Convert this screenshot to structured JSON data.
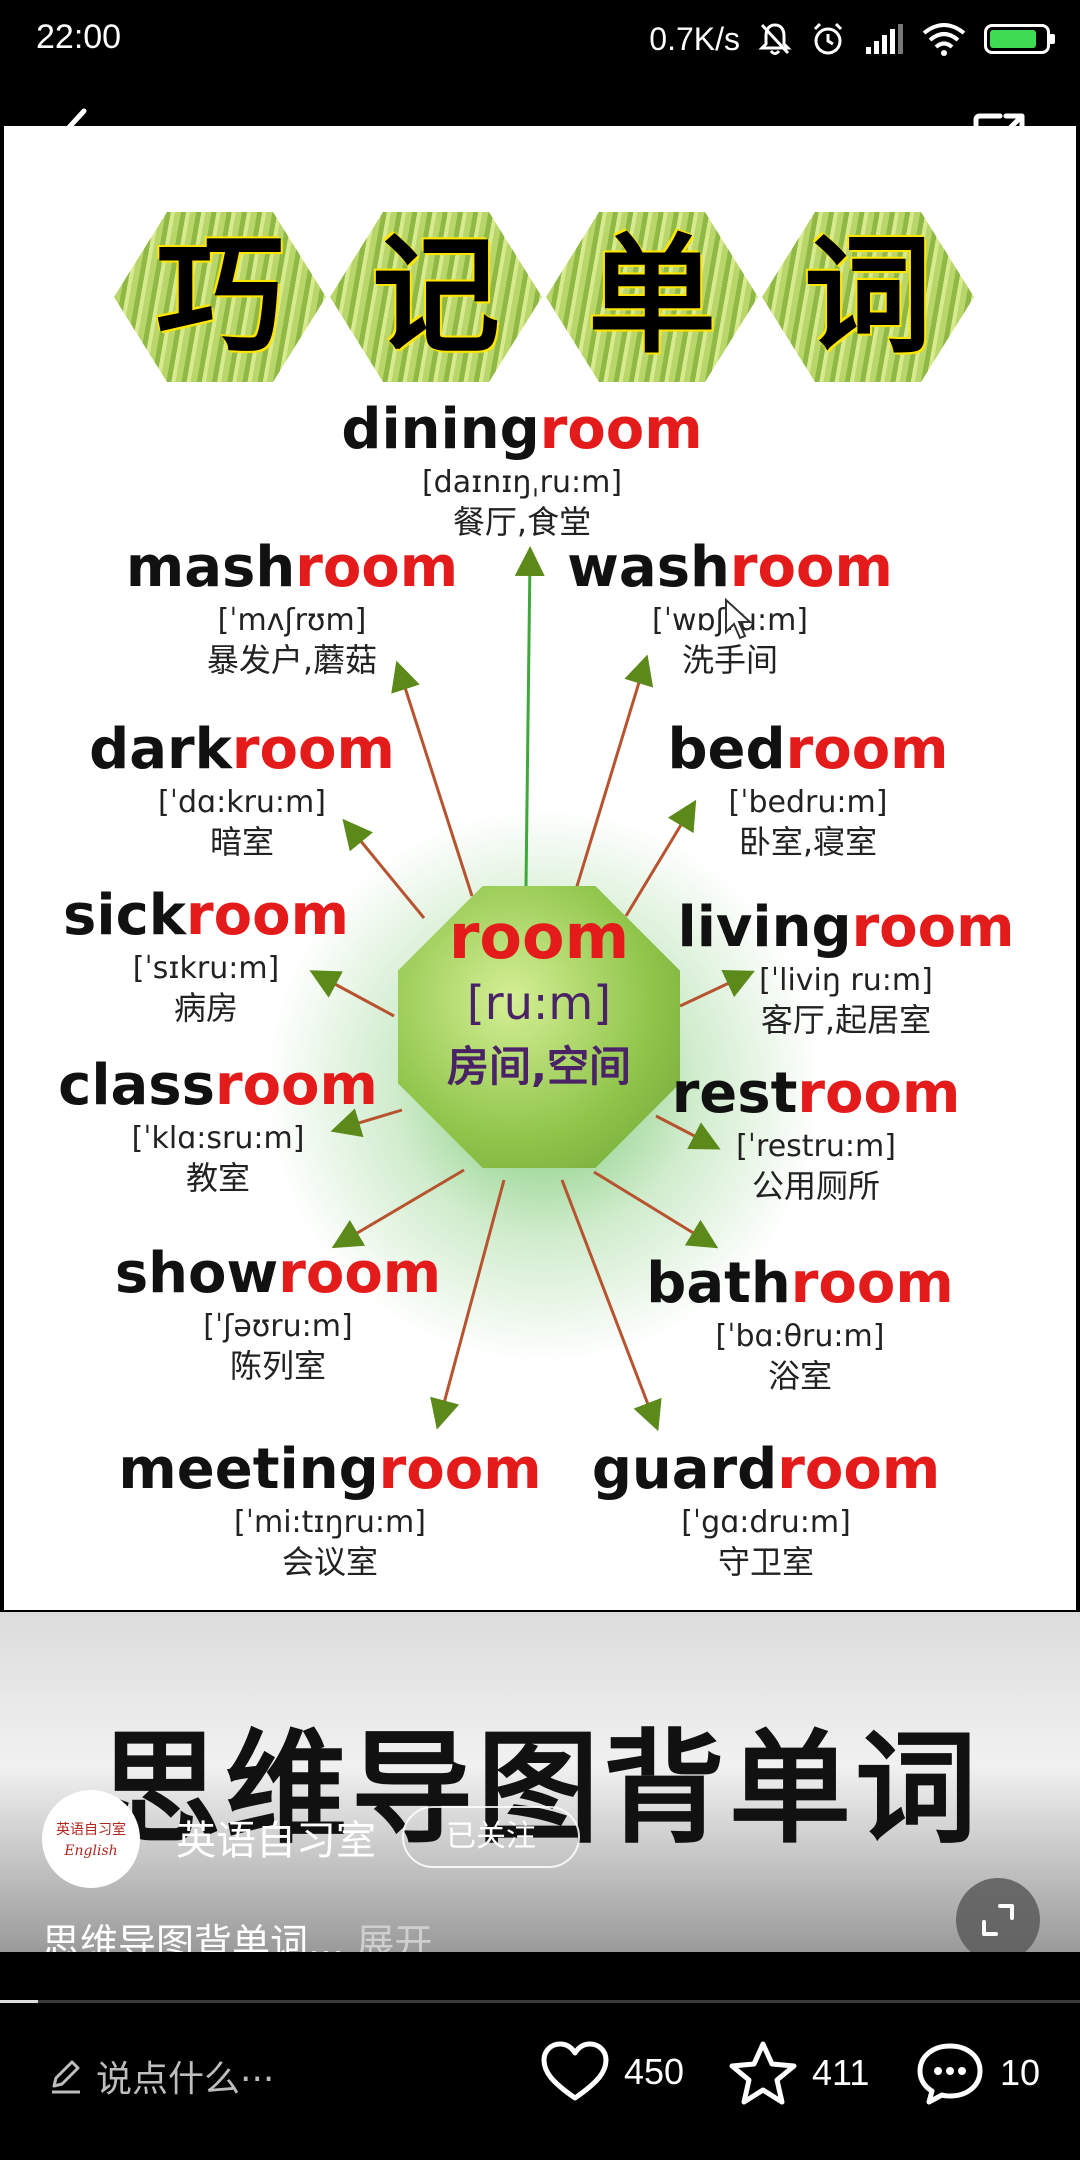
{
  "status_bar": {
    "time": "22:00",
    "net_speed": "0.7K/s",
    "battery_level": 0.85
  },
  "poster": {
    "title_chars": [
      "巧",
      "记",
      "单",
      "词"
    ],
    "center": {
      "word": "room",
      "ipa": "[ru:m]",
      "cn": "房间,空间"
    },
    "words": [
      {
        "prefix": "dining",
        "suffix": "room",
        "ipa": "[daɪnɪŋˌru:m]",
        "cn": "餐厅,食堂"
      },
      {
        "prefix": "mash",
        "suffix": "room",
        "ipa": "[ˈmʌʃrʊm]",
        "cn": "暴发户,蘑菇"
      },
      {
        "prefix": "wash",
        "suffix": "room",
        "ipa": "[ˈwɒʃru:m]",
        "cn": "洗手间"
      },
      {
        "prefix": "dark",
        "suffix": "room",
        "ipa": "[ˈdɑ:kru:m]",
        "cn": "暗室"
      },
      {
        "prefix": "bed",
        "suffix": "room",
        "ipa": "[ˈbedru:m]",
        "cn": "卧室,寝室"
      },
      {
        "prefix": "sick",
        "suffix": "room",
        "ipa": "[ˈsɪkru:m]",
        "cn": "病房"
      },
      {
        "prefix": "living",
        "suffix": "room",
        "ipa": "[ˈliviŋ ru:m]",
        "cn": "客厅,起居室"
      },
      {
        "prefix": "class",
        "suffix": "room",
        "ipa": "[ˈklɑ:sru:m]",
        "cn": "教室"
      },
      {
        "prefix": "rest",
        "suffix": "room",
        "ipa": "[ˈrestru:m]",
        "cn": "公用厕所"
      },
      {
        "prefix": "show",
        "suffix": "room",
        "ipa": "[ˈʃəʊru:m]",
        "cn": "陈列室"
      },
      {
        "prefix": "bath",
        "suffix": "room",
        "ipa": "[ˈbɑ:θru:m]",
        "cn": "浴室"
      },
      {
        "prefix": "meeting",
        "suffix": "room",
        "ipa": "[ˈmi:tɪŋru:m]",
        "cn": "会议室"
      },
      {
        "prefix": "guard",
        "suffix": "room",
        "ipa": "[ˈgɑ:dru:m]",
        "cn": "守卫室"
      }
    ]
  },
  "banner": {
    "title": "思维导图背单词"
  },
  "author": {
    "name": "英语自习室",
    "follow_label": "已关注",
    "avatar_text": "英语自习室",
    "avatar_sub": "English"
  },
  "description": {
    "text": "思维导图背单词...",
    "more": "展开"
  },
  "playback": {
    "progress": 0.035
  },
  "bottom_bar": {
    "comment_placeholder": "说点什么···",
    "likes": "450",
    "favorites": "411",
    "comments": "10"
  }
}
